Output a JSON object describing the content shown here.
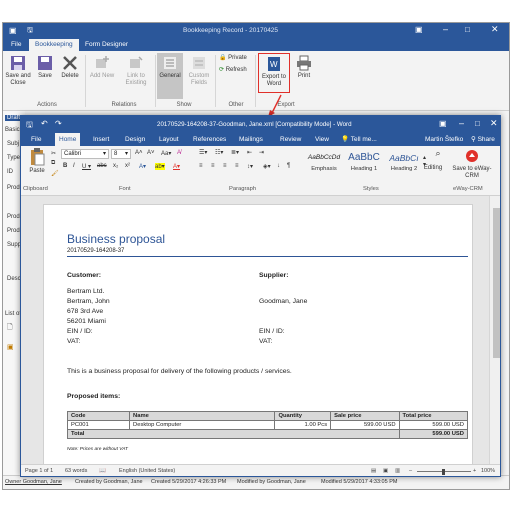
{
  "outer": {
    "title": "Bookkeeping Record - 20170425",
    "tabs": [
      "File",
      "Bookkeeping",
      "Form Designer"
    ],
    "ribbon": {
      "save_close": "Save and Close",
      "save": "Save",
      "delete": "Delete",
      "add_new": "Add New",
      "link_existing": "Link to Existing",
      "general": "General",
      "custom_fields": "Custom Fields",
      "private": "Private",
      "refresh": "Refresh",
      "export_word": "Export to Word",
      "print": "Print",
      "groups": [
        "Actions",
        "Relations",
        "Show",
        "Other",
        "Export"
      ]
    },
    "left_labels": [
      "Draft",
      "Basic",
      "Subj",
      "Type",
      "ID",
      "Prod",
      "Prod",
      "Prod",
      "Supp",
      "Desc",
      "List of"
    ],
    "status": {
      "owner": "Owner Goodman, Jane",
      "created_by": "Created by Goodman, Jane",
      "created": "Created 5/29/2017 4:26:33 PM",
      "modified_by": "Modified by Goodman, Jane",
      "modified": "Modified 5/29/2017 4:33:05 PM"
    }
  },
  "word": {
    "title": "20170529-164208-37-Goodman, Jane.xml [Compatibility Mode] - Word",
    "tabs": [
      "File",
      "Home",
      "Insert",
      "Design",
      "Layout",
      "References",
      "Mailings",
      "Review",
      "View"
    ],
    "tell_me": "Tell me...",
    "user": "Martin Štefko",
    "share": "Share",
    "ribbon": {
      "paste": "Paste",
      "font_name": "Calibri",
      "font_size": "8",
      "styles": [
        {
          "sample": "AaBbCcDd",
          "name": "Emphasis"
        },
        {
          "sample": "AaBbC",
          "name": "Heading 1"
        },
        {
          "sample": "AaBbCı",
          "name": "Heading 2"
        }
      ],
      "editing": "Editing",
      "save_to": "Save to eWay-CRM",
      "groups": [
        "Clipboard",
        "Font",
        "Paragraph",
        "Styles",
        "eWay-CRM"
      ]
    },
    "status": {
      "page": "Page 1 of 1",
      "words": "63 words",
      "language": "English (United States)",
      "zoom": "100%"
    }
  },
  "doc": {
    "title": "Business proposal",
    "number": "20170529-164208-37",
    "customer_label": "Customer:",
    "supplier_label": "Supplier:",
    "customer_lines": [
      "Bertram Ltd.",
      "Bertram, John",
      "678 3rd Ave",
      "56201 Miami",
      "EIN / ID:",
      "VAT:"
    ],
    "supplier_lines": [
      "",
      "Goodman, Jane",
      "",
      "",
      "EIN / ID:",
      "VAT:"
    ],
    "intro": "This is a business proposal for delivery of the following products / services.",
    "items_label": "Proposed items:",
    "table": {
      "headers": [
        "Code",
        "Name",
        "Quantity",
        "Sale price",
        "Total price"
      ],
      "rows": [
        [
          "PC001",
          "Desktop Computer",
          "1.00 Pcs",
          "599.00 USD",
          "599.00 USD"
        ]
      ],
      "total_label": "Total",
      "total_value": "599.00 USD"
    },
    "note": "Note: Prices are without VAT"
  },
  "colors": {
    "word_blue": "#2b579a",
    "highlight_red": "#e0302a",
    "heading_blue": "#2e5596"
  }
}
